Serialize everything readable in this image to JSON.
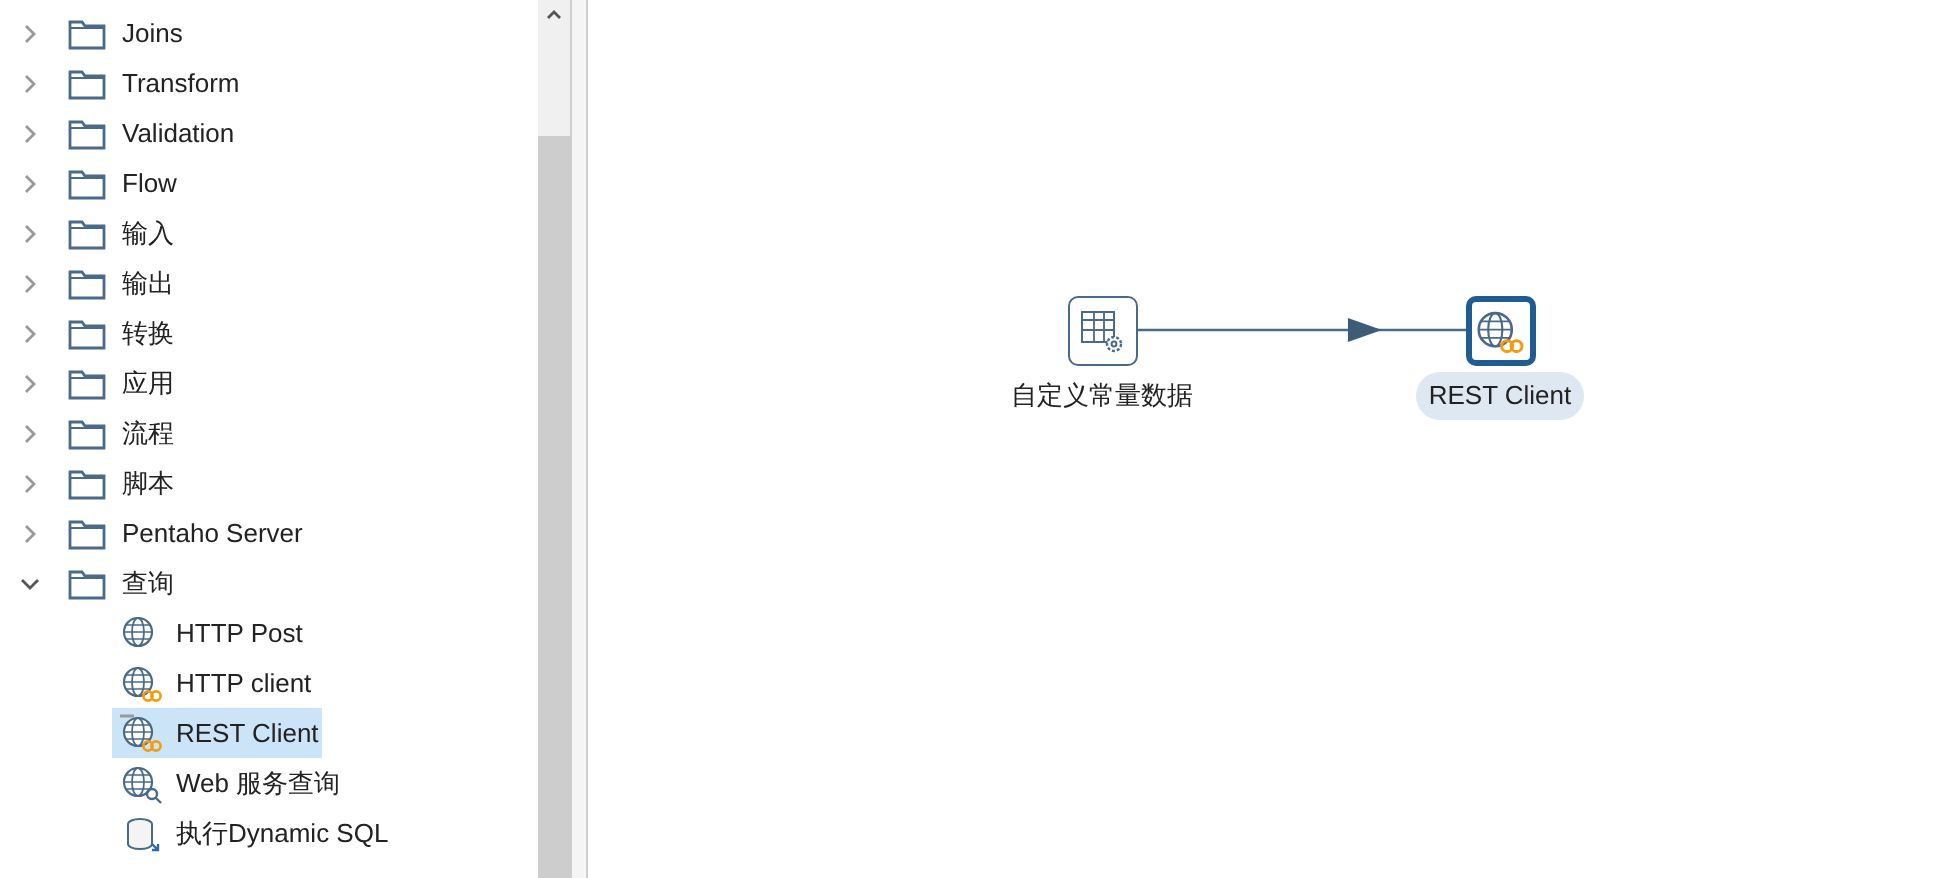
{
  "tree": [
    {
      "label": "Joins",
      "expanded": false
    },
    {
      "label": "Transform",
      "expanded": false
    },
    {
      "label": "Validation",
      "expanded": false
    },
    {
      "label": "Flow",
      "expanded": false
    },
    {
      "label": "输入",
      "expanded": false
    },
    {
      "label": "输出",
      "expanded": false
    },
    {
      "label": "转换",
      "expanded": false
    },
    {
      "label": "应用",
      "expanded": false
    },
    {
      "label": "流程",
      "expanded": false
    },
    {
      "label": "脚本",
      "expanded": false
    },
    {
      "label": "Pentaho Server",
      "expanded": false
    },
    {
      "label": "查询",
      "expanded": true,
      "children": [
        {
          "label": "HTTP Post",
          "kind": "globe",
          "selected": false
        },
        {
          "label": "HTTP client",
          "kind": "globe-link",
          "selected": false
        },
        {
          "label": "REST Client",
          "kind": "rest",
          "selected": true
        },
        {
          "label": "Web 服务查询",
          "kind": "globe-search",
          "selected": false
        },
        {
          "label": "执行Dynamic SQL",
          "kind": "sql",
          "selected": false
        }
      ]
    }
  ],
  "canvas": {
    "nodes": [
      {
        "label": "自定义常量数据",
        "kind": "table",
        "selected": false
      },
      {
        "label": "REST Client",
        "kind": "rest",
        "selected": true
      }
    ]
  }
}
